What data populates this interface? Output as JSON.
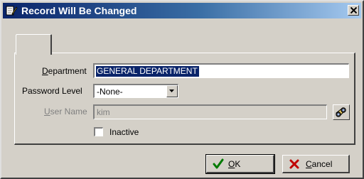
{
  "window": {
    "title": "Record Will Be Changed",
    "icons": {
      "app": "pencil-document-icon",
      "close": "close-icon"
    }
  },
  "form": {
    "department": {
      "label_mnemonic": "D",
      "label_rest": "epartment",
      "value": "GENERAL DEPARTMENT",
      "selected": true
    },
    "password_level": {
      "label": "Password Level",
      "value": "-None-"
    },
    "user_name": {
      "label_mnemonic": "U",
      "label_rest": "ser Name",
      "value": "kim",
      "enabled": false,
      "lookup_icon": "binoculars-icon"
    },
    "inactive": {
      "label": "Inactive",
      "checked": false
    }
  },
  "buttons": {
    "ok": {
      "mnemonic": "O",
      "rest": "K",
      "icon": "checkmark-icon",
      "icon_color": "#007a00"
    },
    "cancel": {
      "mnemonic": "C",
      "rest": "ancel",
      "icon": "x-icon",
      "icon_color": "#c00000"
    }
  },
  "colors": {
    "title_gradient_start": "#0a246a",
    "title_gradient_end": "#a6caf0",
    "face": "#d4d0c8",
    "selection": "#0a246a"
  }
}
